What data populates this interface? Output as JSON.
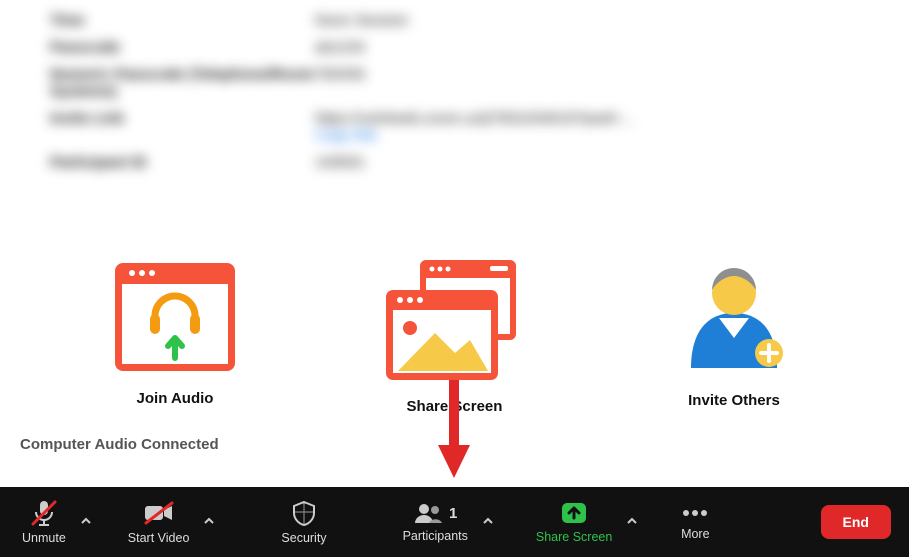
{
  "info": {
    "rows": [
      {
        "label": "Time",
        "value": "Noon Session"
      },
      {
        "label": "Passcode",
        "value": "ab1234"
      },
      {
        "label": "Numeric Passcode (Telephone/Room Systems)",
        "value": "783456"
      },
      {
        "label": "Invite Link",
        "value": "https://us04web.zoom.us/j/7831034019?pwd=..."
      },
      {
        "label": "Participant ID",
        "value": "140001"
      }
    ],
    "copy_link_label": "Copy link"
  },
  "tiles": {
    "join_audio": "Join Audio",
    "share_screen": "Share Screen",
    "invite_others": "Invite Others"
  },
  "audio_status": "Computer Audio Connected",
  "toolbar": {
    "unmute": "Unmute",
    "start_video": "Start Video",
    "security": "Security",
    "participants": "Participants",
    "participants_count": "1",
    "share_screen": "Share Screen",
    "more": "More",
    "end": "End"
  }
}
